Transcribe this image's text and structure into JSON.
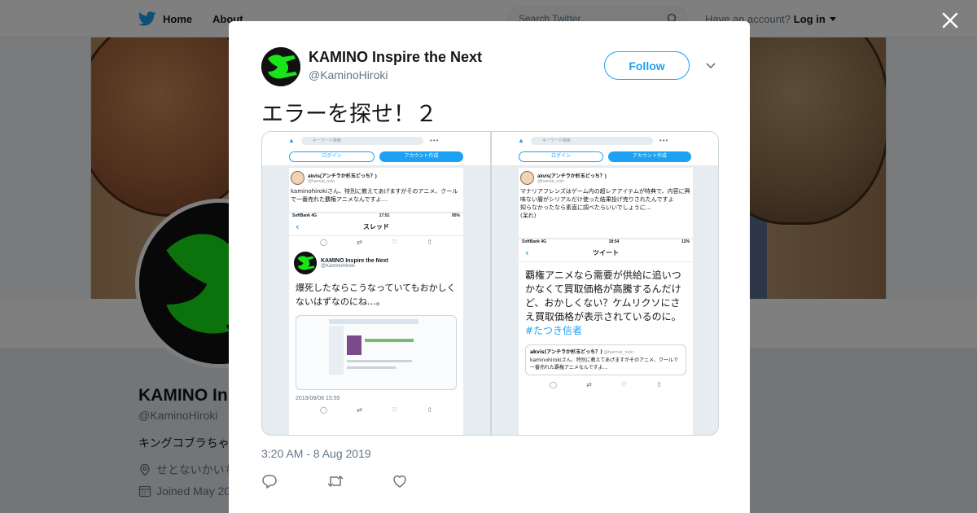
{
  "nav": {
    "home_label": "Home",
    "about_label": "About",
    "search_placeholder": "Search Twitter",
    "have_account": "Have an account?",
    "login_label": "Log in"
  },
  "profile": {
    "name": "KAMINO Inspire the Next",
    "name_visible": "KAMINO In",
    "handle": "@KaminoHiroki",
    "bio": "キングコブラちゃ",
    "location": "せとないかいち",
    "joined": "Joined May 20"
  },
  "tweet": {
    "author_name": "KAMINO Inspire the Next",
    "author_handle": "@KaminoHiroki",
    "follow_label": "Follow",
    "text": "エラーを探せ！２",
    "timestamp": "3:20 AM - 8 Aug 2019"
  },
  "media": {
    "left": {
      "search_placeholder": "キーワード検索",
      "login_label": "ログイン",
      "signup_label": "アカウント作成",
      "reply_name": "akvis(アンチラか杉玉どっち？)",
      "reply_handle": "@harmat_noln",
      "reply_text": "kaminohirokiさん、特別に教えてあげますがそのアニメ、クールで一番売れた覇権アニメなんですよ…",
      "carrier": "SoftBank  4G",
      "clock": "17:51",
      "battery": "95%",
      "header_title": "スレッド",
      "tweet_name": "KAMINO Inspire the Next",
      "tweet_handle": "@KaminoHiroki",
      "tweet_body": "爆死したならこうなっていてもおかしくないはずなのにね…。",
      "tweet_time": "2019/08/08 15:55"
    },
    "right": {
      "search_placeholder": "キーワード検索",
      "login_label": "ログイン",
      "signup_label": "アカウント作成",
      "reply_name": "akvis(アンチラか杉玉どっち？)",
      "reply_handle": "@harmat_noln",
      "reply_text": "マナリアフレンズはゲーム内の超レアアイテムが特典で、内容に興味ない層がシリアルだけ使った結果投げ売りされたんですよ\n知らなかったなら素直に調べたらいいでしょうに…\n(呆れ)",
      "carrier": "SoftBank  4G",
      "clock": "18:54",
      "battery": "12%",
      "header_title": "ツイート",
      "tweet_body": "覇権アニメなら需要が供給に追いつかなくて買取価格が高騰するんだけど、おかしくない？ケムリクソにさえ買取価格が表示されているのに。",
      "hashtag": "#たつき信者",
      "quote_name": "akvis(アンチラか杉玉どっち？)",
      "quote_handle": "@harmat_noln",
      "quote_text": "kaminohirokiさん、特別に教えてあげますがそのアニメ、クールで一番売れた覇権アニメなんですよ…"
    }
  },
  "colors": {
    "accent": "#1da1f2",
    "logo_green": "#19e619",
    "overlay": "rgba(0,0,0,0.5)"
  },
  "icons": [
    "twitter-bird-icon",
    "search-icon",
    "close-icon",
    "chevron-down-icon",
    "reply-icon",
    "retweet-icon",
    "like-icon",
    "location-icon",
    "calendar-icon"
  ]
}
